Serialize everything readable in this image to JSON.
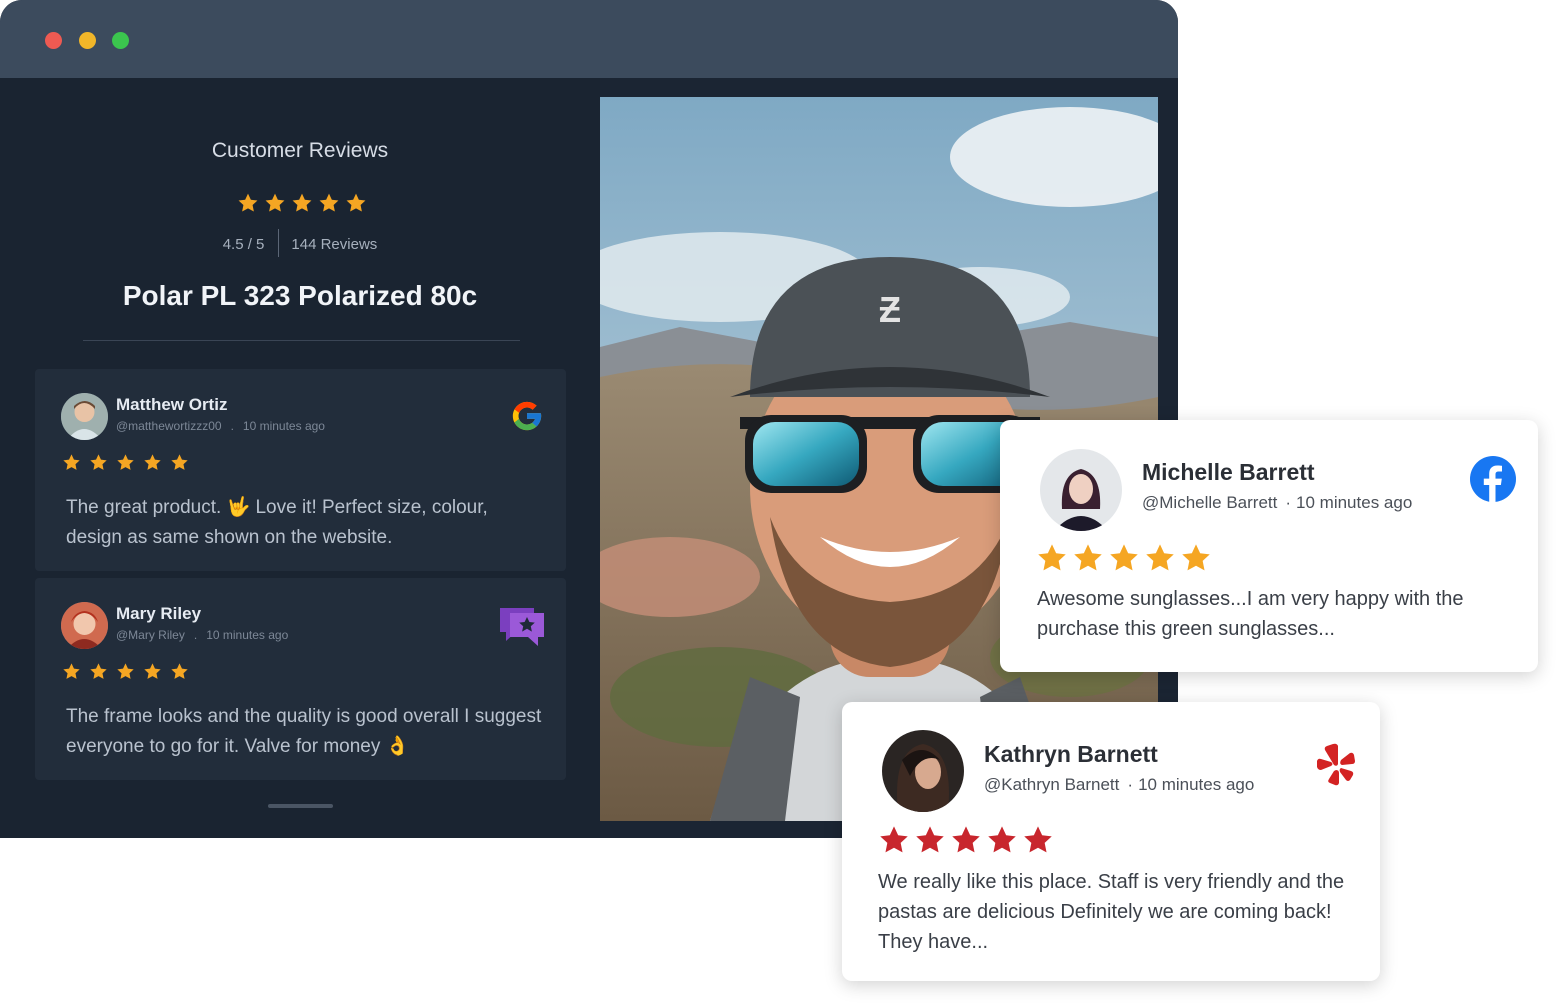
{
  "widget": {
    "title": "Customer Reviews",
    "rating": "4.5 / 5",
    "review_count": "144 Reviews",
    "product": "Polar PL 323 Polarized 80c",
    "star_color": "#f5a623"
  },
  "reviews": [
    {
      "name": "Matthew Ortiz",
      "handle": "@matthewortizzz00",
      "time": "10 minutes ago",
      "stars": 5,
      "text": "The great product. 🤟 Love it!  Perfect size, colour, design as same shown on the website.",
      "source": "google-icon"
    },
    {
      "name": "Mary Riley",
      "handle": "@Mary Riley",
      "time": "10 minutes ago",
      "stars": 5,
      "text": "The frame looks and the quality is good overall I suggest everyone to go for it. Valve for money 👌",
      "source": "review-platform-icon"
    }
  ],
  "cards": [
    {
      "name": "Michelle Barrett",
      "handle": "@Michelle Barrett",
      "time": "10 minutes ago",
      "stars": 5,
      "star_color": "#f5a623",
      "text": "Awesome sunglasses...I am very happy with the purchase this green sunglasses...",
      "source": "facebook-icon"
    },
    {
      "name": "Kathryn Barnett",
      "handle": "@Kathryn Barnett",
      "time": "10 minutes ago",
      "stars": 5,
      "star_color": "#c8262d",
      "text": "We really like this place.  Staff is very friendly and the pastas are delicious Definitely we are coming back!  They have...",
      "source": "yelp-icon"
    }
  ]
}
